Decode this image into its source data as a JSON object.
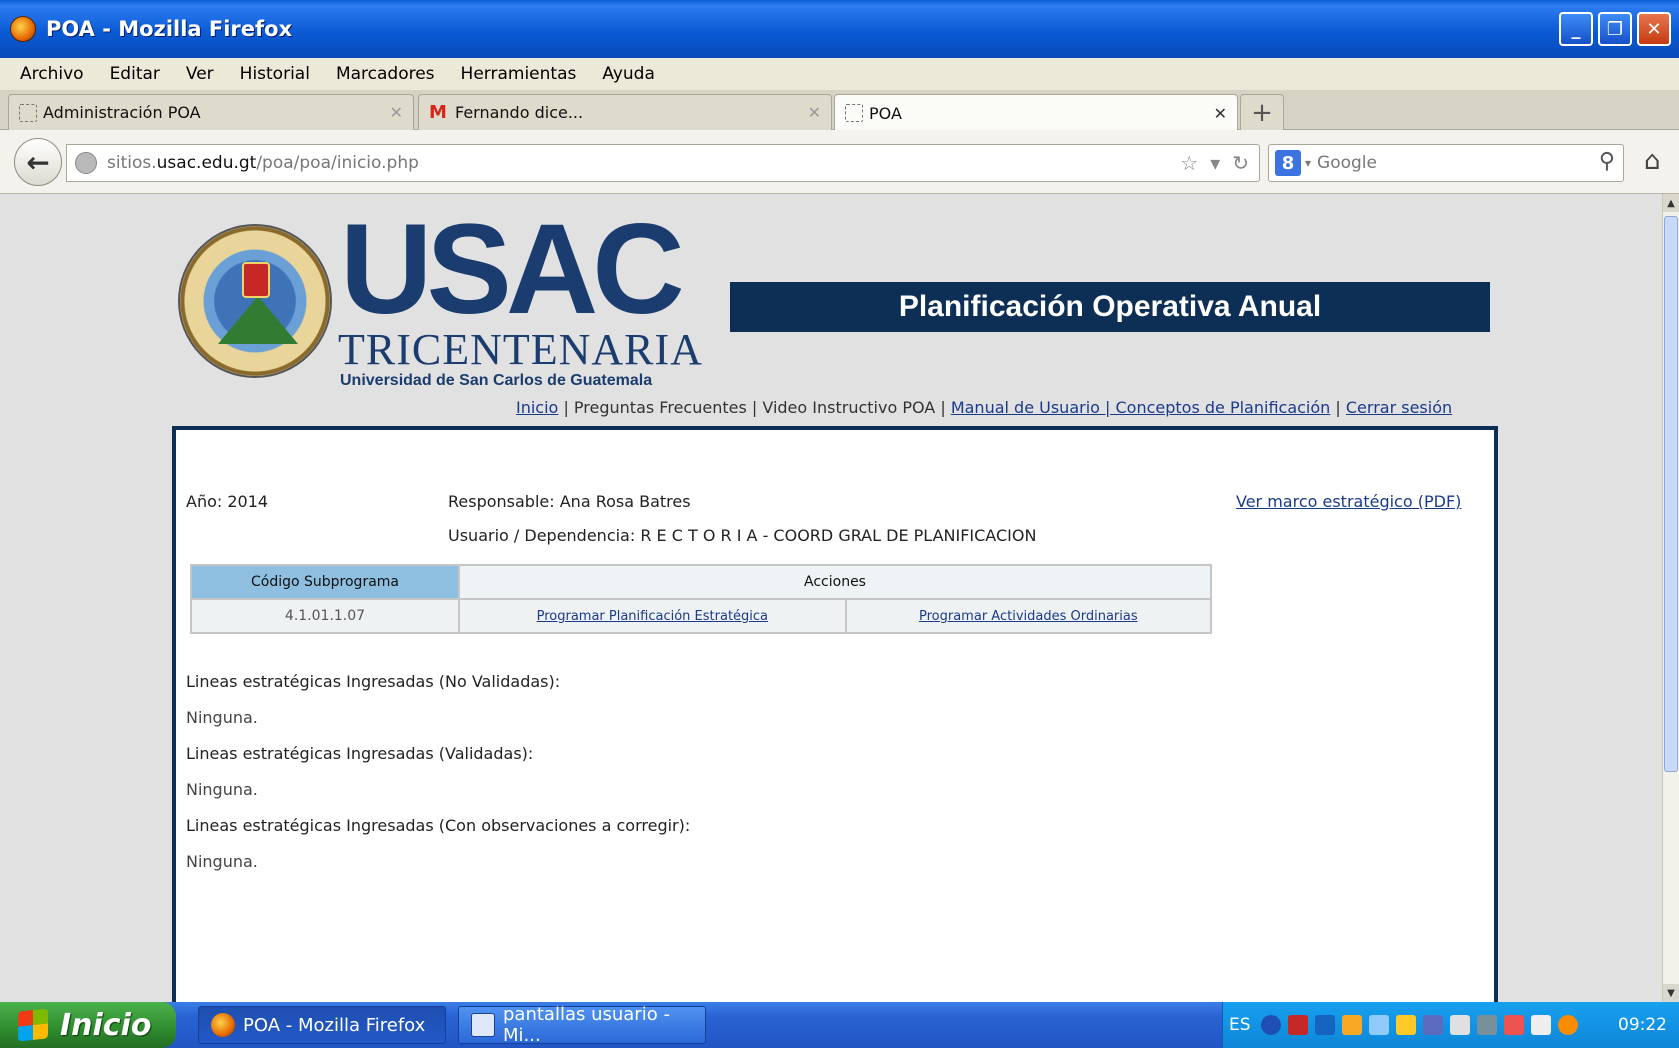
{
  "window": {
    "title": "POA - Mozilla Firefox"
  },
  "menu": [
    "Archivo",
    "Editar",
    "Ver",
    "Historial",
    "Marcadores",
    "Herramientas",
    "Ayuda"
  ],
  "tabs": [
    {
      "label": "Administración POA"
    },
    {
      "label": "Fernando dice..."
    },
    {
      "label": "POA"
    }
  ],
  "address": {
    "prefix": "sitios.",
    "domain": "usac.edu.gt",
    "path": "/poa/poa/inicio.php"
  },
  "search": {
    "placeholder": "Google"
  },
  "header": {
    "logo_main": "USAC",
    "logo_sub1": "TRICENTENARIA",
    "logo_sub2": "Universidad de San Carlos de Guatemala",
    "banner": "Planificación Operativa Anual"
  },
  "topnav": {
    "inicio": "Inicio",
    "preguntas": "Preguntas Frecuentes",
    "video": "Video Instructivo POA",
    "manual": "Manual de Usuario | Conceptos de Planificación",
    "cerrar": "Cerrar sesión",
    "sep": "|"
  },
  "info": {
    "year": "Año: 2014",
    "responsable": "Responsable: Ana Rosa Batres",
    "usuario": "Usuario / Dependencia: R E C T O R I A - COORD GRAL DE PLANIFICACION",
    "marco_link": "Ver marco estratégico (PDF)"
  },
  "table": {
    "headers": [
      "Código Subprograma",
      "Acciones"
    ],
    "row": {
      "code": "4.1.01.1.07",
      "action1": "Programar Planificación Estratégica",
      "action2": "Programar Actividades Ordinarias"
    }
  },
  "sections": [
    {
      "title": "Lineas estratégicas Ingresadas (No Validadas):",
      "value": "Ninguna."
    },
    {
      "title": "Lineas estratégicas Ingresadas (Validadas):",
      "value": "Ninguna."
    },
    {
      "title": "Lineas estratégicas Ingresadas (Con observaciones a corregir):",
      "value": "Ninguna."
    }
  ],
  "taskbar": {
    "start": "Inicio",
    "tasks": [
      "POA - Mozilla Firefox",
      "pantallas usuario - Mi..."
    ],
    "lang": "ES",
    "clock": "09:22"
  }
}
